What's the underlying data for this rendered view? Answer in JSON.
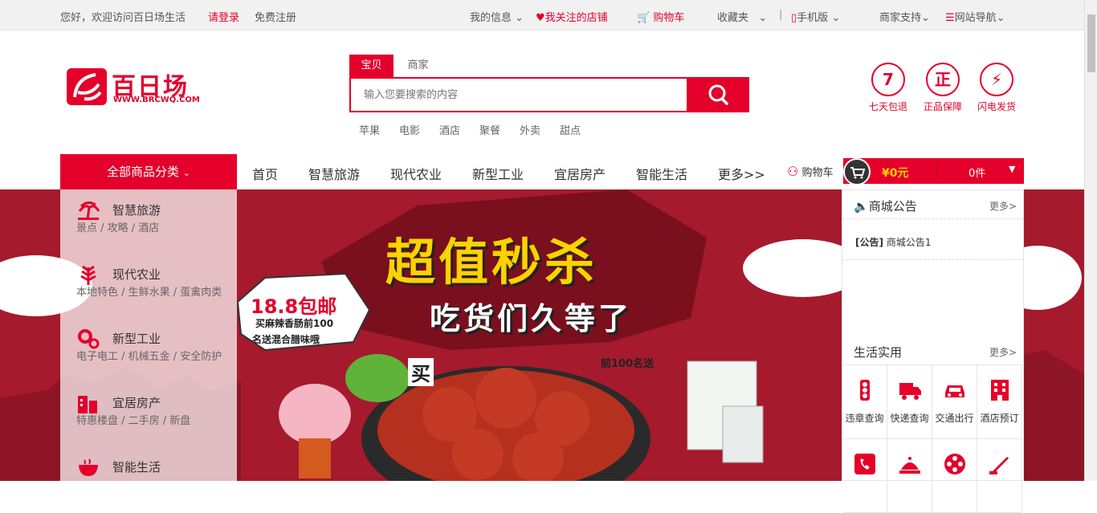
{
  "topbar": {
    "greeting": "您好，欢迎访问百日场生活",
    "login": "请登录",
    "register": "免费注册",
    "my_info": "我的信息",
    "followed_shops": "我关注的店铺",
    "cart": "购物车",
    "favorites": "收藏夹",
    "mobile": "手机版",
    "merchant_support": "商家支持",
    "site_nav": "网站导航"
  },
  "logo": {
    "name": "百日场",
    "url_text": "WWW.BRCWQ.COM"
  },
  "search": {
    "tab_active": "宝贝",
    "tab_inactive": "商家",
    "placeholder": "输入您要搜索的内容",
    "hotwords": [
      "苹果",
      "电影",
      "酒店",
      "聚餐",
      "外卖",
      "甜点"
    ]
  },
  "services": [
    {
      "glyph": "7",
      "label": "七天包退"
    },
    {
      "glyph": "正",
      "label": "正品保障"
    },
    {
      "glyph": "⚡",
      "label": "闪电发货"
    }
  ],
  "nav": {
    "all_categories": "全部商品分类",
    "items": [
      "首页",
      "智慧旅游",
      "现代农业",
      "新型工业",
      "宜居房产",
      "智能生活",
      "更多>>"
    ],
    "cart_label": "购物车",
    "cart_amount": "¥0元",
    "cart_count": "0件"
  },
  "categories": [
    {
      "title": "智慧旅游",
      "subs": "景点  /  攻略  /  酒店"
    },
    {
      "title": "现代农业",
      "subs": "本地特色  /  生鲜水果  /  蛋禽肉类"
    },
    {
      "title": "新型工业",
      "subs": "电子电工  /  机械五金  /  安全防护"
    },
    {
      "title": "宜居房产",
      "subs": "特惠楼盘  /  二手房  /  新盘"
    },
    {
      "title": "智能生活",
      "subs": ""
    }
  ],
  "banner": {
    "headline": "超值秒杀",
    "subline": "吃货们久等了",
    "badge_big": "18.8包邮",
    "badge_line1": "买麻辣香肠前100",
    "badge_line2": "名送混合腊味哦",
    "buy_word": "买",
    "top100": "前100名送"
  },
  "notice": {
    "title": "商城公告",
    "more": "更多>",
    "tag": "[公告]",
    "item": "商城公告1"
  },
  "life": {
    "title": "生活实用",
    "more": "更多>",
    "items": [
      "违章查询",
      "快递查询",
      "交通出行",
      "酒店预订"
    ]
  }
}
